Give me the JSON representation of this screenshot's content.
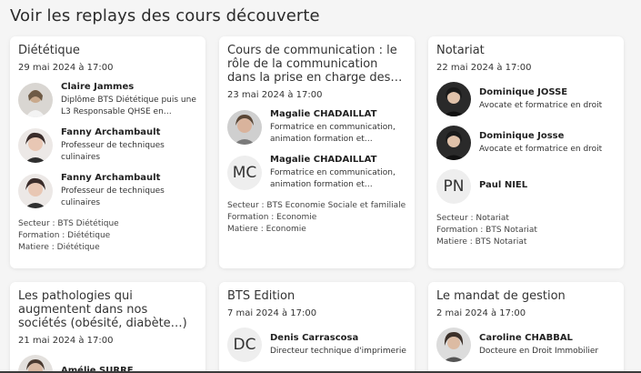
{
  "page": {
    "heading": "Voir les replays des cours découverte"
  },
  "cards": [
    {
      "title": "Diététique",
      "date": "29 mai 2024 à 17:00",
      "people": [
        {
          "name": "Claire Jammes",
          "role": "Diplôme BTS Diététique puis une L3 Responsable QHSE en industrie",
          "avatar": "photo"
        },
        {
          "name": "Fanny Archambault",
          "role": "Professeur de techniques culinaires",
          "avatar": "photo"
        },
        {
          "name": "Fanny Archambault",
          "role": "Professeur de techniques culinaires",
          "avatar": "photo"
        }
      ],
      "meta": [
        "Secteur : BTS Diététique",
        "Formation : Diététique",
        "Matiere : Diététique"
      ]
    },
    {
      "title": "Cours de communication : le rôle de la communication dans la prise en charge des…",
      "date": "23 mai 2024 à 17:00",
      "people": [
        {
          "name": "Magalie CHADAILLAT",
          "role": "Formatrice en communication, animation formation et…",
          "avatar": "photo"
        },
        {
          "name": "Magalie CHADAILLAT",
          "role": "Formatrice en communication, animation formation et…",
          "avatar": "initials",
          "initials": "MC"
        }
      ],
      "meta": [
        "Secteur : BTS Economie Sociale et familiale",
        "Formation : Economie",
        "Matiere : Economie"
      ]
    },
    {
      "title": "Notariat",
      "date": "22 mai 2024 à 17:00",
      "people": [
        {
          "name": "Dominique JOSSE",
          "role": "Avocate et formatrice en droit",
          "avatar": "photo"
        },
        {
          "name": "Dominique Josse",
          "role": "Avocate et formatrice en droit",
          "avatar": "photo"
        },
        {
          "name": "Paul NIEL",
          "role": "",
          "avatar": "initials",
          "initials": "PN"
        }
      ],
      "meta": [
        "Secteur : Notariat",
        "Formation : BTS Notariat",
        "Matiere : BTS Notariat"
      ]
    },
    {
      "title": "Les pathologies qui augmentent dans nos sociétés (obésité, diabète…)",
      "date": "21 mai 2024 à 17:00",
      "people": [
        {
          "name": "Amélie SURRE",
          "role": "",
          "avatar": "photo"
        }
      ],
      "meta": []
    },
    {
      "title": "BTS Edition",
      "date": "7 mai 2024 à 17:00",
      "people": [
        {
          "name": "Denis Carrascosa",
          "role": "Directeur technique d'imprimerie",
          "avatar": "initials",
          "initials": "DC"
        }
      ],
      "meta": []
    },
    {
      "title": "Le mandat de gestion",
      "date": "2 mai 2024 à 17:00",
      "people": [
        {
          "name": "Caroline CHABBAL",
          "role": "Docteure en Droit Immobilier",
          "avatar": "photo"
        }
      ],
      "meta": []
    }
  ]
}
